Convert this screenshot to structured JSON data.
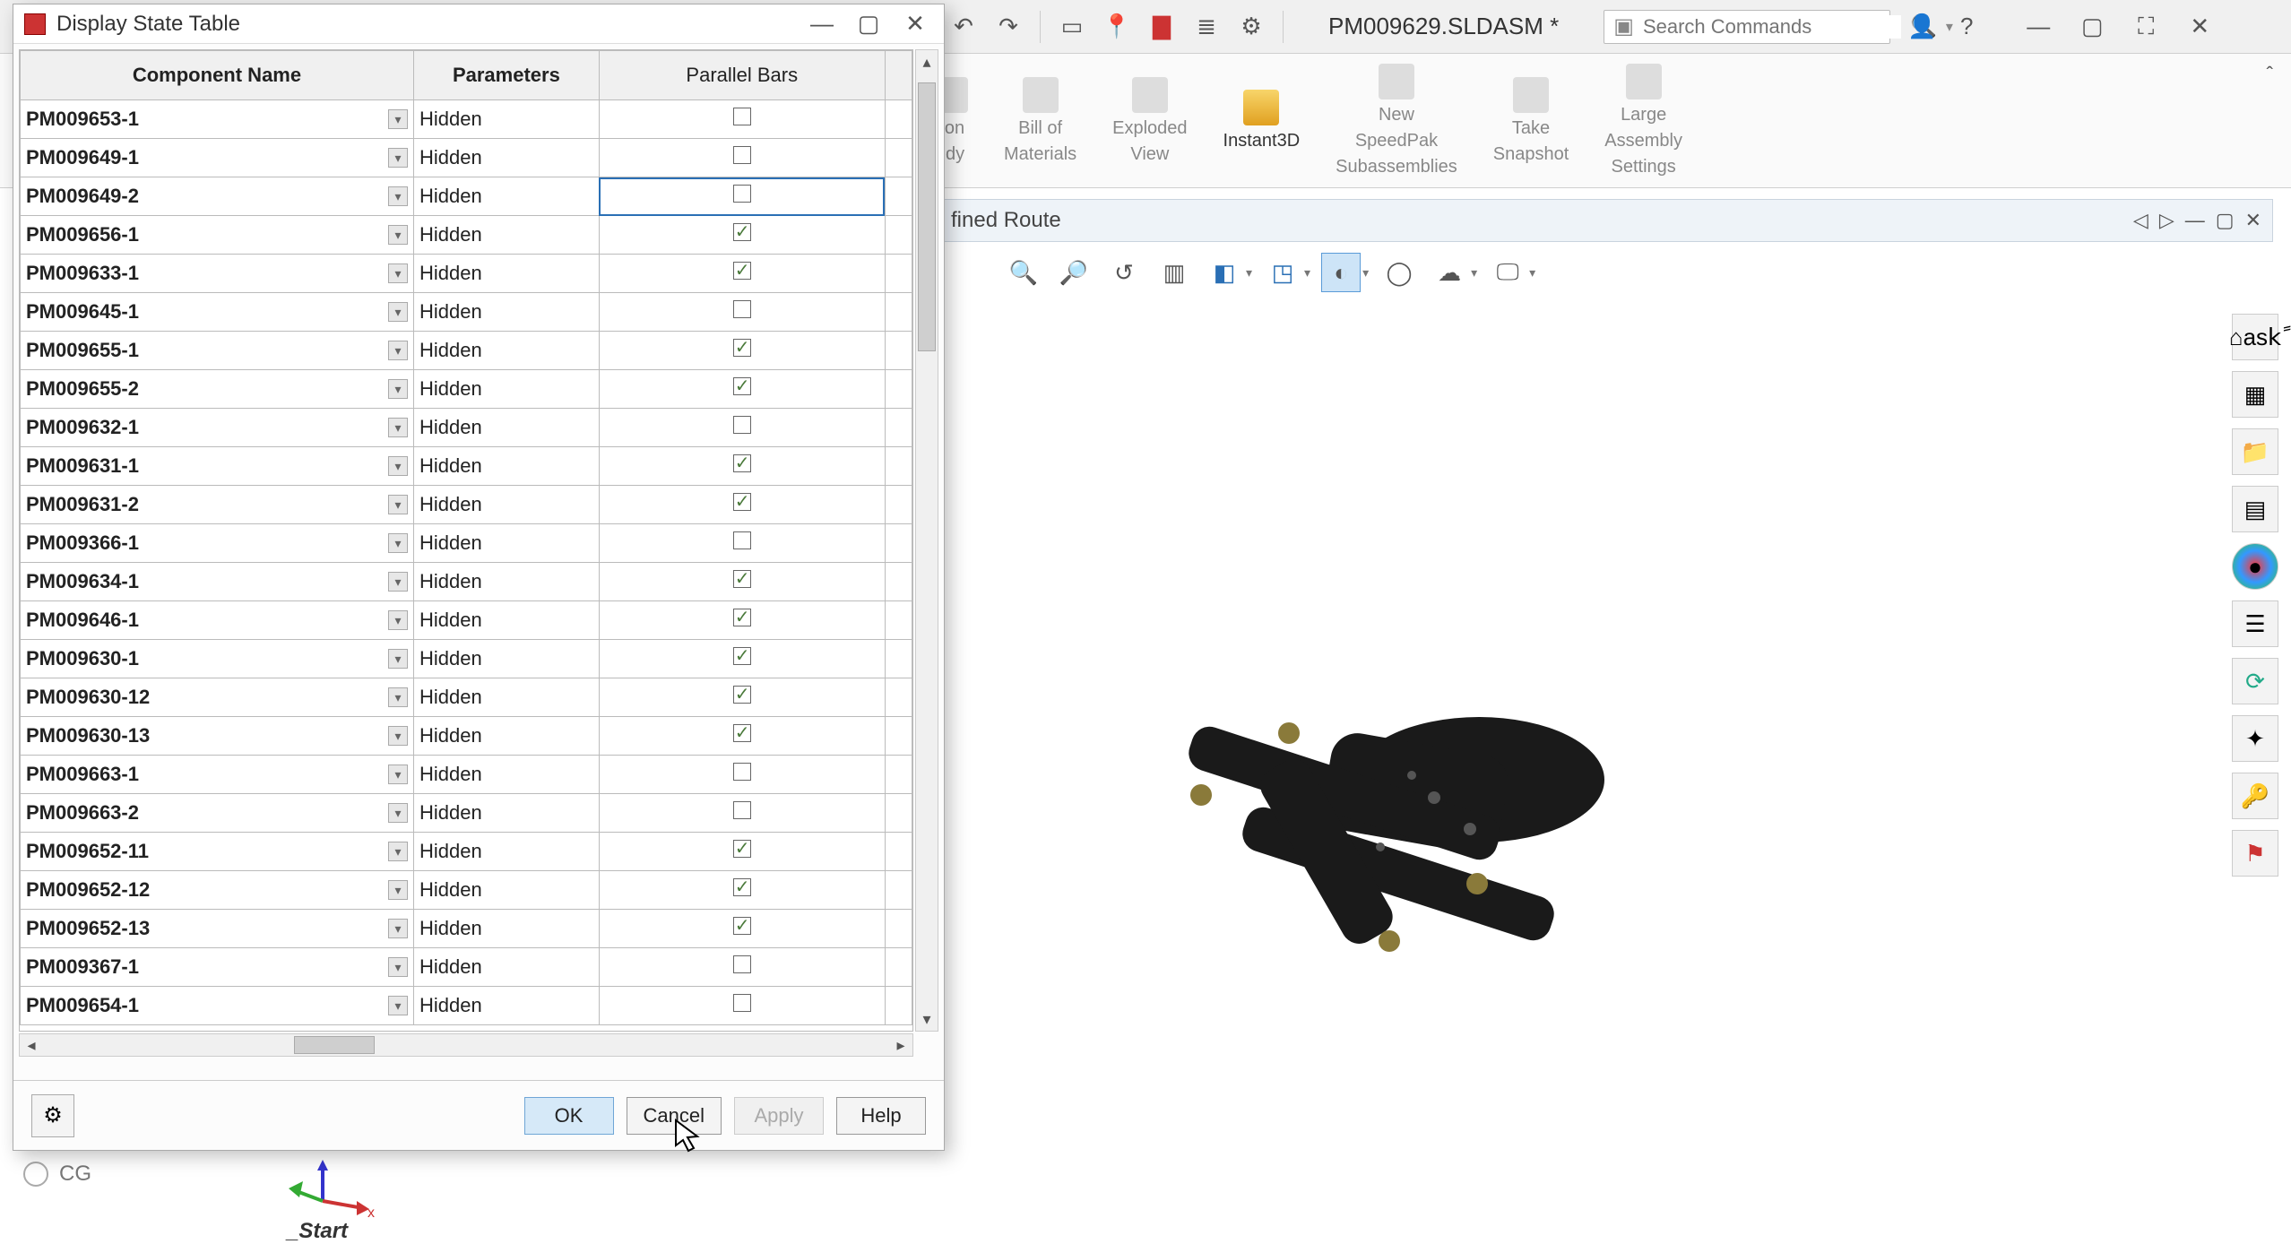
{
  "app": {
    "document_title": "PM009629.SLDASM *",
    "search_placeholder": "Search Commands",
    "tab_label": "fined Route",
    "bottom_tab": "_Start",
    "cg_label": "CG"
  },
  "ribbon": {
    "items": [
      {
        "label1": "tion",
        "label2": "udy",
        "enabled": false
      },
      {
        "label1": "Bill of",
        "label2": "Materials",
        "enabled": false
      },
      {
        "label1": "Exploded",
        "label2": "View",
        "enabled": false
      },
      {
        "label1": "Instant3D",
        "label2": "",
        "enabled": true
      },
      {
        "label1": "New",
        "label2": "SpeedPak",
        "label3": "Subassemblies",
        "enabled": false
      },
      {
        "label1": "Take",
        "label2": "Snapshot",
        "enabled": false
      },
      {
        "label1": "Large",
        "label2": "Assembly",
        "label3": "Settings",
        "enabled": false
      }
    ]
  },
  "modal": {
    "title": "Display State Table",
    "columns": {
      "name": "Component Name",
      "params": "Parameters",
      "parallel": "Parallel Bars"
    },
    "buttons": {
      "ok": "OK",
      "cancel": "Cancel",
      "apply": "Apply",
      "help": "Help"
    },
    "rows": [
      {
        "name": "PM009653-1",
        "param": "Hidden",
        "checked": false
      },
      {
        "name": "PM009649-1",
        "param": "Hidden",
        "checked": false
      },
      {
        "name": "PM009649-2",
        "param": "Hidden",
        "checked": false,
        "selected": true
      },
      {
        "name": "PM009656-1",
        "param": "Hidden",
        "checked": true
      },
      {
        "name": "PM009633-1",
        "param": "Hidden",
        "checked": true
      },
      {
        "name": "PM009645-1",
        "param": "Hidden",
        "checked": false
      },
      {
        "name": "PM009655-1",
        "param": "Hidden",
        "checked": true
      },
      {
        "name": "PM009655-2",
        "param": "Hidden",
        "checked": true
      },
      {
        "name": "PM009632-1",
        "param": "Hidden",
        "checked": false
      },
      {
        "name": "PM009631-1",
        "param": "Hidden",
        "checked": true
      },
      {
        "name": "PM009631-2",
        "param": "Hidden",
        "checked": true
      },
      {
        "name": "PM009366-1",
        "param": "Hidden",
        "checked": false
      },
      {
        "name": "PM009634-1",
        "param": "Hidden",
        "checked": true
      },
      {
        "name": "PM009646-1",
        "param": "Hidden",
        "checked": true
      },
      {
        "name": "PM009630-1",
        "param": "Hidden",
        "checked": true
      },
      {
        "name": "PM009630-12",
        "param": "Hidden",
        "checked": true
      },
      {
        "name": "PM009630-13",
        "param": "Hidden",
        "checked": true
      },
      {
        "name": "PM009663-1",
        "param": "Hidden",
        "checked": false
      },
      {
        "name": "PM009663-2",
        "param": "Hidden",
        "checked": false
      },
      {
        "name": "PM009652-11",
        "param": "Hidden",
        "checked": true
      },
      {
        "name": "PM009652-12",
        "param": "Hidden",
        "checked": true
      },
      {
        "name": "PM009652-13",
        "param": "Hidden",
        "checked": true
      },
      {
        "name": "PM009367-1",
        "param": "Hidden",
        "checked": false
      },
      {
        "name": "PM009654-1",
        "param": "Hidden",
        "checked": false
      }
    ]
  }
}
